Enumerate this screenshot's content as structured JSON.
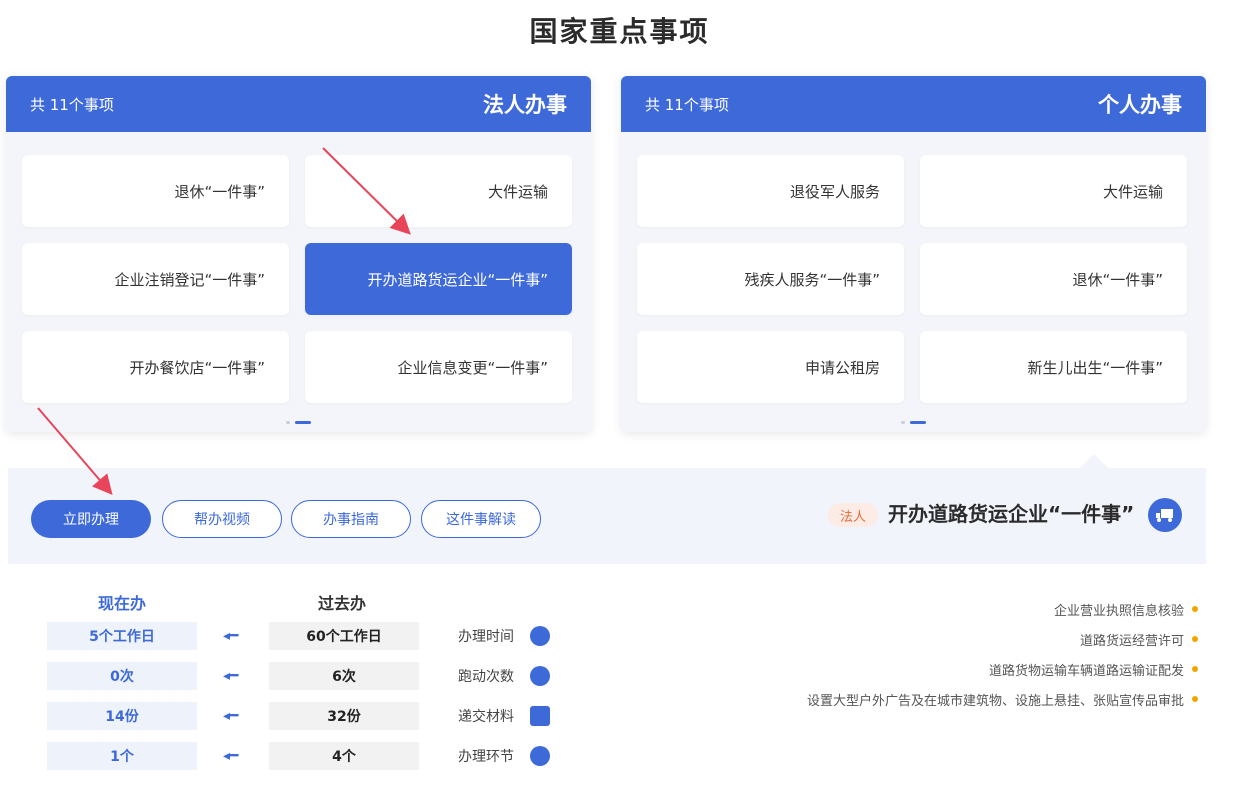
{
  "page": {
    "title": "国家重点事项"
  },
  "panels": {
    "corporate": {
      "name": "法人办事",
      "count": "共 11个事项",
      "items": [
        "大件运输",
        "退休“一件事”",
        "开办道路货运企业“一件事”",
        "企业注销登记“一件事”",
        "企业信息变更“一件事”",
        "开办餐饮店“一件事”"
      ]
    },
    "personal": {
      "name": "个人办事",
      "count": "共 11个事项",
      "items": [
        "大件运输",
        "退役军人服务",
        "退休“一件事”",
        "残疾人服务“一件事”",
        "新生儿出生“一件事”",
        "申请公租房"
      ]
    }
  },
  "detail": {
    "title": "开办道路货运企业“一件事”",
    "tag": "法人",
    "buttons": {
      "apply": "立即办理",
      "guide_video": "帮办视频",
      "guide": "办事指南",
      "interpretation": "这件事解读"
    }
  },
  "compare": {
    "now_header": "现在办",
    "past_header": "过去办",
    "rows": [
      {
        "label": "办理时间",
        "now": "5个工作日",
        "past": "60个工作日"
      },
      {
        "label": "跑动次数",
        "now": "0次",
        "past": "6次"
      },
      {
        "label": "递交材料",
        "now": "14份",
        "past": "32份"
      },
      {
        "label": "办理环节",
        "now": "1个",
        "past": "4个"
      }
    ]
  },
  "bullets": [
    "企业营业执照信息核验",
    "道路货运经营许可",
    "道路货物运输车辆道路运输证配发",
    "设置大型户外广告及在城市建筑物、设施上悬挂、张贴宣传品审批"
  ],
  "colors": {
    "primary": "#3d69d9",
    "tag": "#e76b3c",
    "bullet": "#f2a400"
  }
}
